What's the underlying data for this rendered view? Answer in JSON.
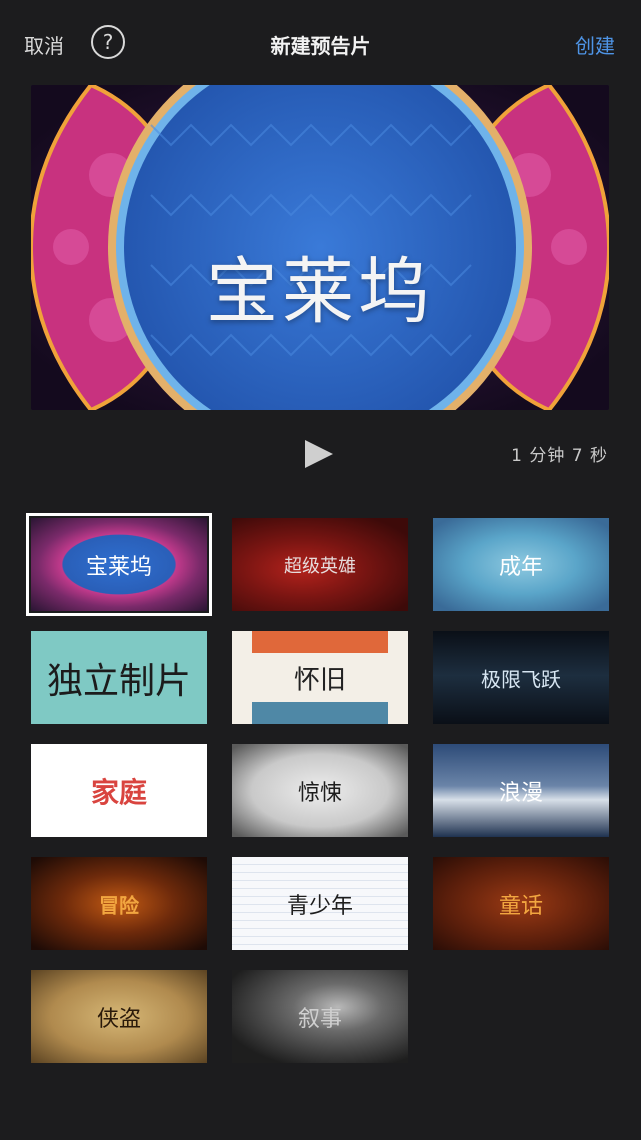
{
  "header": {
    "cancel": "取消",
    "help_icon": "question-circle-icon",
    "title": "新建预告片",
    "create": "创建",
    "accent": "#4e94e6"
  },
  "preview": {
    "title": "宝莱坞",
    "duration": "1 分钟 7 秒"
  },
  "themes": [
    {
      "label": "宝莱坞",
      "selected": true
    },
    {
      "label": "超级英雄"
    },
    {
      "label": "成年"
    },
    {
      "label": "独立制片"
    },
    {
      "label": "怀旧"
    },
    {
      "label": "极限飞跃"
    },
    {
      "label": "家庭",
      "color": "#d9443f"
    },
    {
      "label": "惊悚"
    },
    {
      "label": "浪漫"
    },
    {
      "label": "冒险",
      "color": "#f2a640"
    },
    {
      "label": "青少年"
    },
    {
      "label": "童话",
      "color": "#f2a640"
    },
    {
      "label": "侠盗"
    },
    {
      "label": "叙事"
    }
  ]
}
